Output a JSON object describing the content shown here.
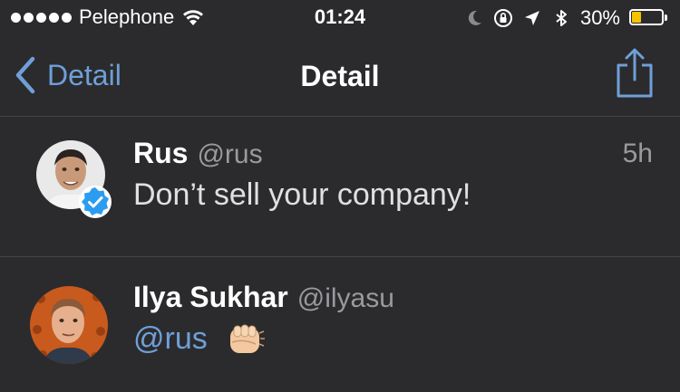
{
  "status_bar": {
    "carrier": "Pelephone",
    "time": "01:24",
    "battery_percent": "30%",
    "battery_level": 0.3,
    "signal_dots": 5,
    "icons": [
      "wifi-icon",
      "moon-icon",
      "orientation-lock-icon",
      "location-arrow-icon",
      "bluetooth-icon",
      "battery-icon"
    ],
    "battery_color": "#f5c400"
  },
  "nav": {
    "back_label": "Detail",
    "title": "Detail",
    "accent": "#6f9fd8"
  },
  "tweets": [
    {
      "name": "Rus",
      "handle": "@rus",
      "time": "5h",
      "text": "Don’t sell your company!",
      "verified": true
    },
    {
      "name": "Ilya Sukhar",
      "handle": "@ilyasu",
      "mention": "@rus",
      "emoji": "fist-bump-emoji"
    }
  ]
}
